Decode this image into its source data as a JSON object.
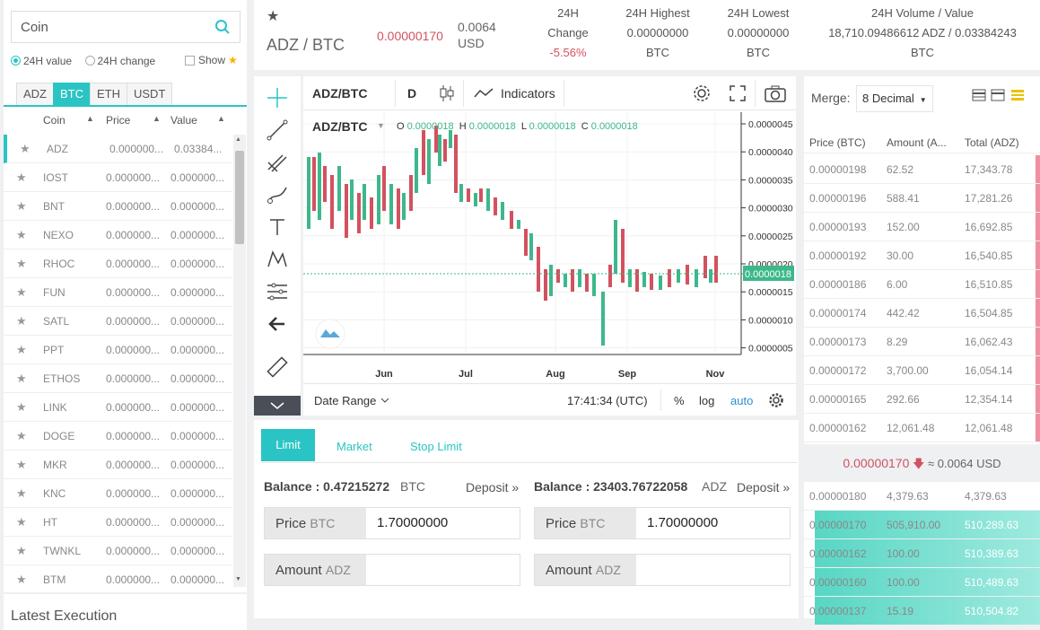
{
  "left": {
    "search_placeholder": "Coin",
    "radio_24h_value": "24H value",
    "radio_24h_change": "24H change",
    "show_label": "Show",
    "market_tabs": [
      "ADZ",
      "BTC",
      "ETH",
      "USDT"
    ],
    "headers": {
      "coin": "Coin",
      "price": "Price",
      "value": "Value"
    },
    "coins": [
      {
        "name": "ADZ",
        "price": "0.000000...",
        "value": "0.03384..."
      },
      {
        "name": "IOST",
        "price": "0.000000...",
        "value": "0.000000..."
      },
      {
        "name": "BNT",
        "price": "0.000000...",
        "value": "0.000000..."
      },
      {
        "name": "NEXO",
        "price": "0.000000...",
        "value": "0.000000..."
      },
      {
        "name": "RHOC",
        "price": "0.000000...",
        "value": "0.000000..."
      },
      {
        "name": "FUN",
        "price": "0.000000...",
        "value": "0.000000..."
      },
      {
        "name": "SATL",
        "price": "0.000000...",
        "value": "0.000000..."
      },
      {
        "name": "PPT",
        "price": "0.000000...",
        "value": "0.000000..."
      },
      {
        "name": "ETHOS",
        "price": "0.000000...",
        "value": "0.000000..."
      },
      {
        "name": "LINK",
        "price": "0.000000...",
        "value": "0.000000..."
      },
      {
        "name": "DOGE",
        "price": "0.000000...",
        "value": "0.000000..."
      },
      {
        "name": "MKR",
        "price": "0.000000...",
        "value": "0.000000..."
      },
      {
        "name": "KNC",
        "price": "0.000000...",
        "value": "0.000000..."
      },
      {
        "name": "HT",
        "price": "0.000000...",
        "value": "0.000000..."
      },
      {
        "name": "TWNKL",
        "price": "0.000000...",
        "value": "0.000000..."
      },
      {
        "name": "BTM",
        "price": "0.000000...",
        "value": "0.000000..."
      }
    ],
    "latest_execution": "Latest Execution"
  },
  "header": {
    "pair": "ADZ / BTC",
    "price": "0.00000170",
    "usd1": "0.0064",
    "usd2": "USD",
    "change_l1": "24H",
    "change_l2": "Change",
    "change_val": "-5.56%",
    "high_label": "24H Highest",
    "high_val": "0.00000000",
    "high_unit": "BTC",
    "low_label": "24H Lowest",
    "low_val": "0.00000000",
    "low_unit": "BTC",
    "vol_label": "24H Volume / Value",
    "vol_val": "18,710.09486612 ADZ / 0.03384243",
    "vol_unit": "BTC"
  },
  "chart": {
    "symbol": "ADZ/BTC",
    "interval": "D",
    "indicators": "Indicators",
    "legend_symbol": "ADZ/BTC",
    "legend": {
      "o": "0.0000018",
      "h": "0.0000018",
      "l": "0.0000018",
      "c": "0.0000018"
    },
    "price_ticks": [
      "0.0000045",
      "0.0000040",
      "0.0000035",
      "0.0000030",
      "0.0000025",
      "0.0000020",
      "0.0000015",
      "0.0000010",
      "0.0000005"
    ],
    "current_price_label": "0.0000018",
    "months": [
      "Jun",
      "Jul",
      "Aug",
      "Sep",
      "Nov"
    ],
    "date_range": "Date Range",
    "time": "17:41:34 (UTC)",
    "pct": "%",
    "log": "log",
    "auto": "auto",
    "colors": {
      "up": "#3db88a",
      "down": "#d2525f"
    }
  },
  "book": {
    "merge_label": "Merge:",
    "merge_value": "8 Decimal",
    "headers": {
      "price": "Price (BTC)",
      "amount": "Amount (A...",
      "total": "Total (ADZ)"
    },
    "asks": [
      {
        "price": "0.00000198",
        "amount": "62.52",
        "total": "17,343.78"
      },
      {
        "price": "0.00000196",
        "amount": "588.41",
        "total": "17,281.26"
      },
      {
        "price": "0.00000193",
        "amount": "152.00",
        "total": "16,692.85"
      },
      {
        "price": "0.00000192",
        "amount": "30.00",
        "total": "16,540.85"
      },
      {
        "price": "0.00000186",
        "amount": "6.00",
        "total": "16,510.85"
      },
      {
        "price": "0.00000174",
        "amount": "442.42",
        "total": "16,504.85"
      },
      {
        "price": "0.00000173",
        "amount": "8.29",
        "total": "16,062.43"
      },
      {
        "price": "0.00000172",
        "amount": "3,700.00",
        "total": "16,054.14"
      },
      {
        "price": "0.00000165",
        "amount": "292.66",
        "total": "12,354.14"
      },
      {
        "price": "0.00000162",
        "amount": "12,061.48",
        "total": "12,061.48"
      }
    ],
    "last_price": "0.00000170",
    "last_usd": "≈ 0.0064 USD",
    "bids": [
      {
        "price": "0.00000180",
        "amount": "4,379.63",
        "total": "4,379.63"
      },
      {
        "price": "0.00000170",
        "amount": "505,910.00",
        "total": "510,289.63"
      },
      {
        "price": "0.00000162",
        "amount": "100.00",
        "total": "510,389.63"
      },
      {
        "price": "0.00000160",
        "amount": "100.00",
        "total": "510,489.63"
      },
      {
        "price": "0.00000137",
        "amount": "15.19",
        "total": "510,504.82"
      }
    ]
  },
  "trade": {
    "tabs": [
      "Limit",
      "Market",
      "Stop Limit"
    ],
    "buy": {
      "balance_label": "Balance : 0.47215272",
      "balance_unit": "BTC",
      "deposit": "Deposit »",
      "price_label": "Price",
      "price_unit": "BTC",
      "price_value": "1.70000000",
      "amount_label": "Amount",
      "amount_unit": "ADZ"
    },
    "sell": {
      "balance_label": "Balance : 23403.76722058",
      "balance_unit": "ADZ",
      "deposit": "Deposit »",
      "price_label": "Price",
      "price_unit": "BTC",
      "price_value": "1.70000000",
      "amount_label": "Amount",
      "amount_unit": "ADZ"
    }
  }
}
